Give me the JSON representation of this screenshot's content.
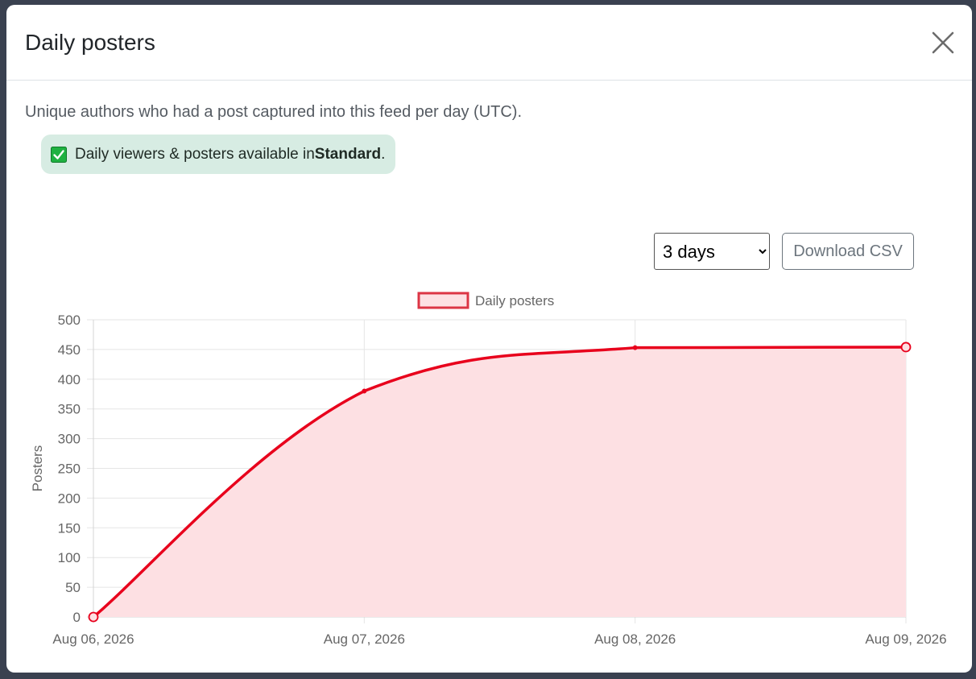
{
  "modal": {
    "title": "Daily posters",
    "description": "Unique authors who had a post captured into this feed per day (UTC).",
    "badge": {
      "prefix": "Daily viewers & posters available in ",
      "plan": "Standard",
      "suffix": "."
    }
  },
  "controls": {
    "range_selected": "3 days",
    "download_label": "Download CSV"
  },
  "colors": {
    "line": "#e8001c",
    "fill": "#fde0e3",
    "accent_badge": "#d7ece3"
  },
  "chart_data": {
    "type": "area",
    "categories": [
      "Aug 06, 2026",
      "Aug 07, 2026",
      "Aug 08, 2026",
      "Aug 09, 2026"
    ],
    "series": [
      {
        "name": "Daily posters",
        "values": [
          0,
          380,
          453,
          454
        ]
      }
    ],
    "ylabel": "Posters",
    "xlabel": "",
    "ylim": [
      0,
      500
    ],
    "yticks": [
      0,
      50,
      100,
      150,
      200,
      250,
      300,
      350,
      400,
      450,
      500
    ],
    "grid": true,
    "legend": "top-center"
  }
}
